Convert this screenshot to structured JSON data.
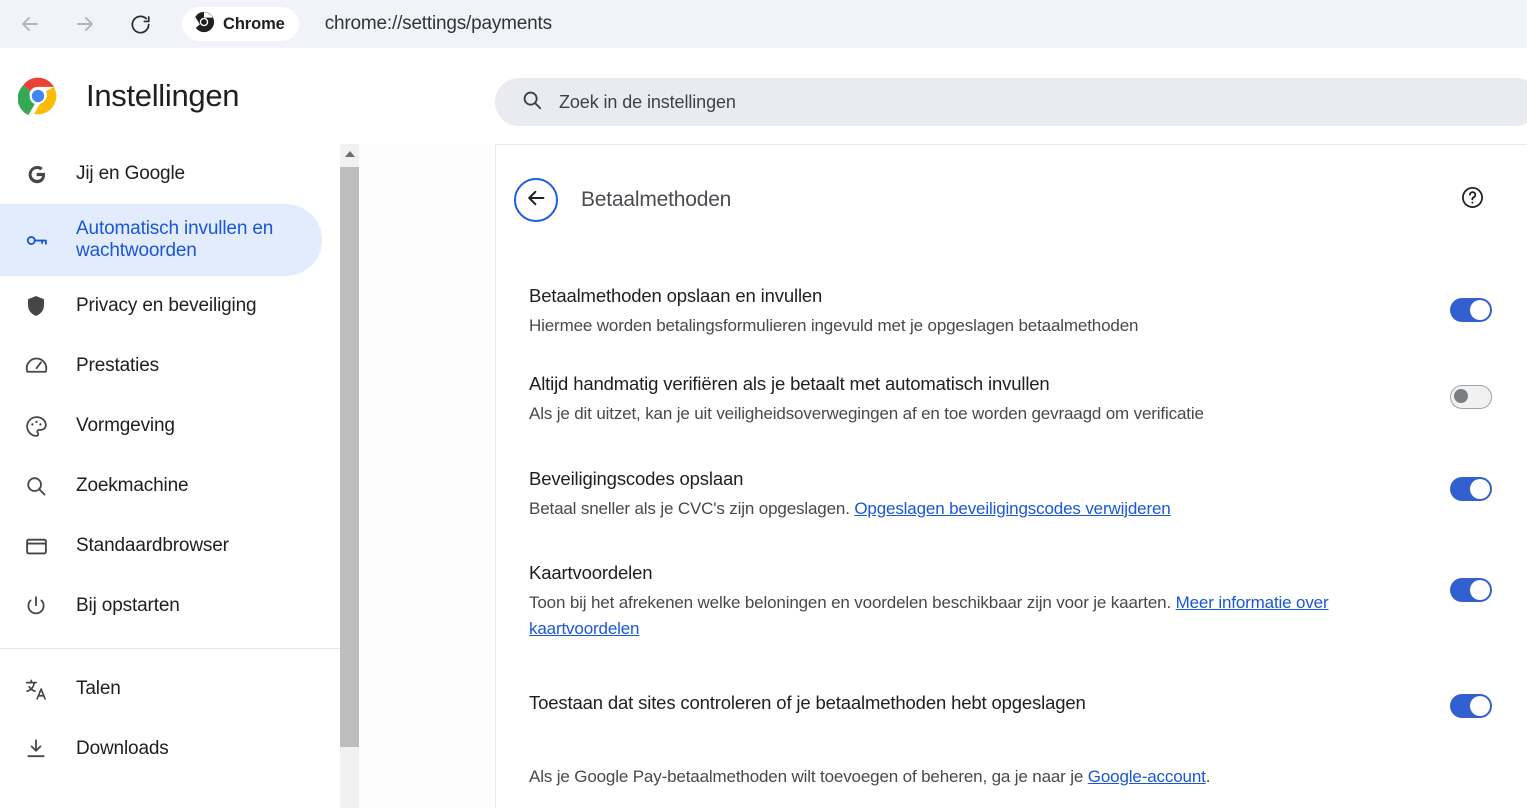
{
  "browser": {
    "nav": {
      "back_icon": "arrow-left-icon",
      "forward_icon": "arrow-right-icon",
      "reload_icon": "reload-icon"
    },
    "badge_label": "Chrome",
    "badge_icon": "chrome-icon",
    "url": "chrome://settings/payments"
  },
  "settings_header": {
    "logo_icon": "chrome-logo-icon",
    "title": "Instellingen",
    "search": {
      "icon": "search-icon",
      "placeholder": "Zoek in de instellingen",
      "value": ""
    }
  },
  "sidebar": {
    "items": [
      {
        "label": "Jij en Google",
        "icon": "google-g-icon",
        "selected": false
      },
      {
        "label": "Automatisch invullen en wachtwoorden",
        "icon": "key-icon",
        "selected": true
      },
      {
        "label": "Privacy en beveiliging",
        "icon": "shield-icon",
        "selected": false
      },
      {
        "label": "Prestaties",
        "icon": "speedometer-icon",
        "selected": false
      },
      {
        "label": "Vormgeving",
        "icon": "palette-icon",
        "selected": false
      },
      {
        "label": "Zoekmachine",
        "icon": "search-icon",
        "selected": false
      },
      {
        "label": "Standaardbrowser",
        "icon": "browser-window-icon",
        "selected": false
      },
      {
        "label": "Bij opstarten",
        "icon": "power-icon",
        "selected": false
      }
    ],
    "items_group2": [
      {
        "label": "Talen",
        "icon": "translate-icon",
        "selected": false
      },
      {
        "label": "Downloads",
        "icon": "download-icon",
        "selected": false
      }
    ],
    "scrollbar": {
      "up_arrow_icon": "scroll-up-arrow-icon"
    }
  },
  "page": {
    "back_icon": "arrow-left-icon",
    "title": "Betaalmethoden",
    "help_icon": "help-circle-icon",
    "rows": [
      {
        "title": "Betaalmethoden opslaan en invullen",
        "desc": "Hiermee worden betalingsformulieren ingevuld met je opgeslagen betaalmethoden",
        "toggle": "on"
      },
      {
        "title": "Altijd handmatig verifiëren als je betaalt met automatisch invullen",
        "desc": "Als je dit uitzet, kan je uit veiligheidsoverwegingen af en toe worden gevraagd om verificatie",
        "toggle": "off"
      },
      {
        "title": "Beveiligingscodes opslaan",
        "desc_pre": "Betaal sneller als je CVC's zijn opgeslagen. ",
        "desc_link": "Opgeslagen beveiligingscodes verwijderen",
        "toggle": "on"
      },
      {
        "title": "Kaartvoordelen",
        "desc_pre": "Toon bij het afrekenen welke beloningen en voordelen beschikbaar zijn voor je kaarten. ",
        "desc_link": "Meer informatie over kaartvoordelen",
        "toggle": "on"
      },
      {
        "title": "Toestaan dat sites controleren of je betaalmethoden hebt opgeslagen",
        "toggle": "on"
      }
    ],
    "footer": {
      "pre": "Als je Google Pay-betaalmethoden wilt toevoegen of beheren, ga je naar je ",
      "link": "Google-account",
      "post": "."
    }
  },
  "colors": {
    "accent_blue": "#1a57d6",
    "toggle_on": "#3260d0",
    "selected_bg": "#e3ecfd",
    "toolbar_bg": "#f1f3f8",
    "search_bg": "#e9ebf1"
  }
}
